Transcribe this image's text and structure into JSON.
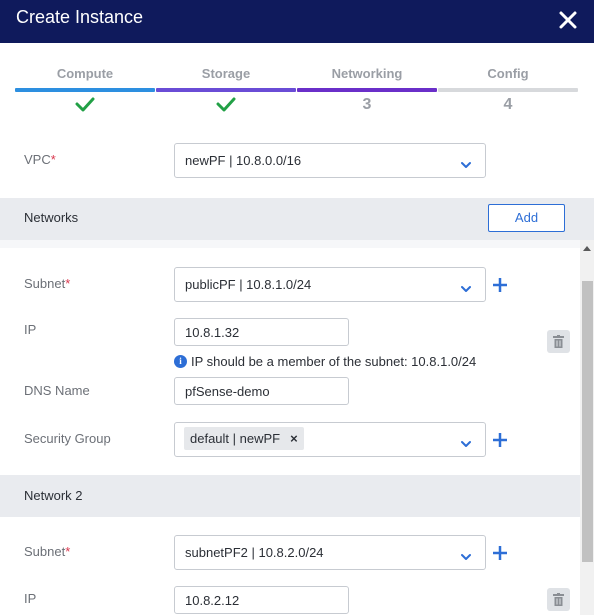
{
  "header": {
    "title": "Create Instance"
  },
  "steps": [
    {
      "label": "Compute",
      "state": "done",
      "mark": "",
      "color": "#2d8fe0"
    },
    {
      "label": "Storage",
      "state": "done",
      "mark": "",
      "color": "#6a4cd6"
    },
    {
      "label": "Networking",
      "state": "active",
      "mark": "3",
      "color": "#6a2fc9"
    },
    {
      "label": "Config",
      "state": "pending",
      "mark": "4",
      "color": "#d7d9dc"
    }
  ],
  "vpc": {
    "label": "VPC",
    "required": "*",
    "value": "newPF | 10.8.0.0/16"
  },
  "networks_section": {
    "title": "Networks",
    "add_label": "Add"
  },
  "network1": {
    "subnet": {
      "label": "Subnet",
      "required": "*",
      "value": "publicPF | 10.8.1.0/24"
    },
    "ip": {
      "label": "IP",
      "value": "10.8.1.32",
      "hint": "IP should be a member of the subnet: 10.8.1.0/24"
    },
    "dns": {
      "label": "DNS Name",
      "value": "pfSense-demo"
    },
    "security_group": {
      "label": "Security Group",
      "tag": "default | newPF"
    }
  },
  "network2_section": {
    "title": "Network 2"
  },
  "network2": {
    "subnet": {
      "label": "Subnet",
      "required": "*",
      "value": "subnetPF2 | 10.8.2.0/24"
    },
    "ip": {
      "label": "IP",
      "value": "10.8.2.12"
    }
  },
  "colors": {
    "header_bg": "#0f1a5c",
    "accent": "#2d6ed6",
    "check": "#22a046",
    "required": "#d9364d"
  }
}
